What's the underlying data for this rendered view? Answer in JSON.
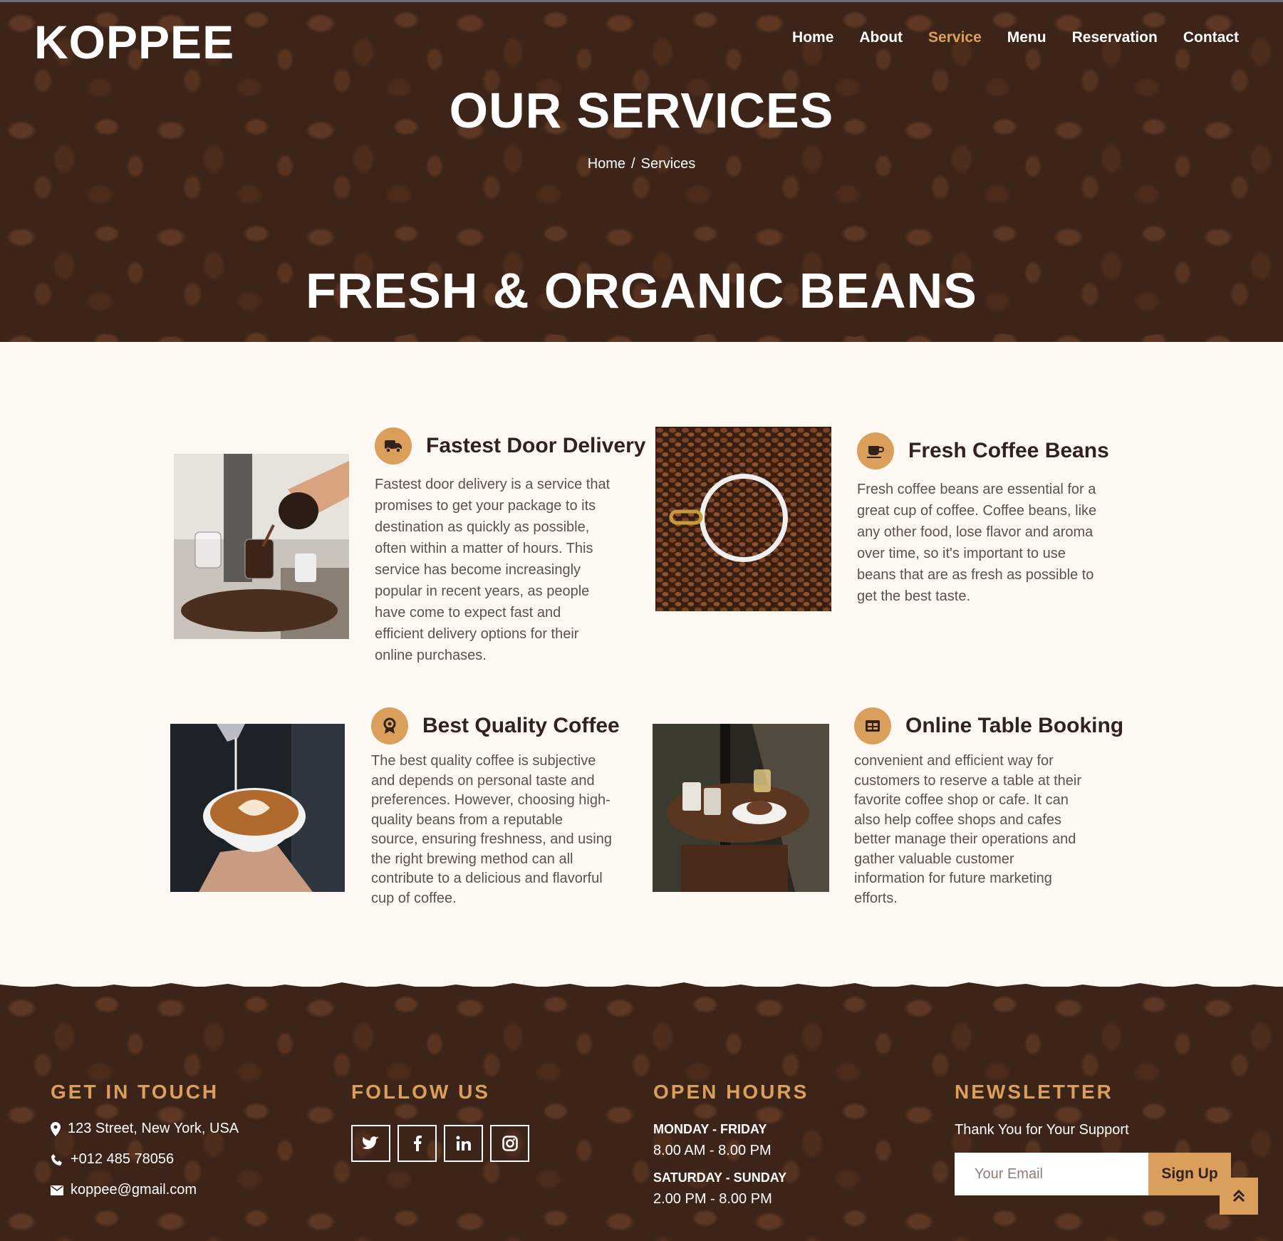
{
  "brand": {
    "logo": "KOPPEE"
  },
  "nav": {
    "items": [
      {
        "label": "Home"
      },
      {
        "label": "About"
      },
      {
        "label": "Service"
      },
      {
        "label": "Menu"
      },
      {
        "label": "Reservation"
      },
      {
        "label": "Contact"
      }
    ],
    "active": "Service"
  },
  "hero": {
    "title": "OUR SERVICES",
    "breadcrumb": {
      "home": "Home",
      "separator": "/",
      "current": "Services"
    }
  },
  "services_section": {
    "title": "FRESH & ORGANIC BEANS",
    "items": [
      {
        "title": "Fastest Door Delivery",
        "icon": "truck-icon",
        "image": "coffee-pouring-photo",
        "lines": [
          "Fastest door delivery is a service that",
          "promises to get your package to its",
          "destination as quickly as possible,",
          "often within a matter of hours. This",
          "service has become increasingly",
          "popular in recent years, as people",
          "have come to expect fast and",
          "efficient delivery options for their",
          "online purchases."
        ]
      },
      {
        "title": "Fresh Coffee Beans",
        "icon": "coffee-cup-icon",
        "image": "coffee-beans-cup-photo",
        "lines": [
          "Fresh coffee beans are essential for a",
          "great cup of coffee. Coffee beans, like",
          "any other food, lose flavor and aroma",
          "over time, so it's important to use",
          "beans that are as fresh as possible to",
          "get the best taste."
        ]
      },
      {
        "title": "Best Quality Coffee",
        "icon": "award-icon",
        "image": "latte-art-photo",
        "lines": [
          "The best quality coffee is subjective",
          "and depends on personal taste and",
          "preferences. However, choosing high-",
          "quality beans from a reputable",
          "source, ensuring freshness, and using",
          "the right brewing method can all",
          "contribute to a delicious and flavorful",
          "cup of coffee."
        ]
      },
      {
        "title": "Online Table Booking",
        "icon": "table-icon",
        "image": "cafe-table-photo",
        "lines": [
          "convenient and efficient way for",
          "customers to reserve a table at their",
          "favorite coffee shop or cafe. It can",
          "also help coffee shops and cafes",
          "better manage their operations and",
          "gather valuable customer",
          "information for future marketing",
          "efforts."
        ]
      }
    ]
  },
  "footer": {
    "contact": {
      "title": "GET IN TOUCH",
      "address": "123 Street, New York, USA",
      "phone": "+012 485 78056",
      "email": "koppee@gmail.com"
    },
    "follow": {
      "title": "FOLLOW US",
      "icons": [
        "twitter-icon",
        "facebook-icon",
        "linkedin-icon",
        "instagram-icon"
      ]
    },
    "hours": {
      "title": "OPEN HOURS",
      "weekday_label": "MONDAY - FRIDAY",
      "weekday_time": "8.00 AM - 8.00 PM",
      "weekend_label": "SATURDAY - SUNDAY",
      "weekend_time": "2.00 PM - 8.00 PM"
    },
    "newsletter": {
      "title": "NEWSLETTER",
      "text": "Thank You for Your Support",
      "placeholder": "Your Email",
      "button": "Sign Up"
    }
  },
  "colors": {
    "accent": "#da9f5b",
    "dark_brown": "#3d2419",
    "heading": "#33211d",
    "cream": "#fdf9f2"
  }
}
